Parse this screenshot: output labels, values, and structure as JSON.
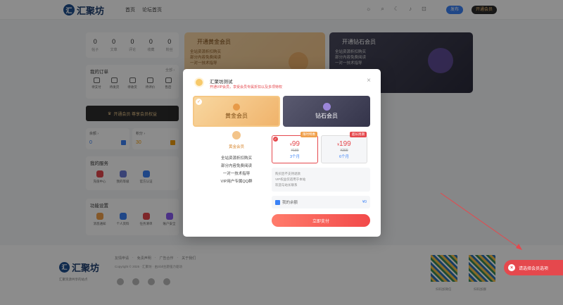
{
  "header": {
    "logo_char": "汇",
    "logo_text": "汇聚坊",
    "nav": [
      "首页",
      "论坛首页"
    ],
    "publish_label": "发布",
    "vip_label": "开通会员"
  },
  "stats": [
    {
      "value": "0",
      "label": "帖子"
    },
    {
      "value": "0",
      "label": "文章"
    },
    {
      "value": "0",
      "label": "评论"
    },
    {
      "value": "0",
      "label": "收藏"
    },
    {
      "value": "0",
      "label": "粉丝"
    }
  ],
  "orders": {
    "title": "我的订单",
    "more": "全部 ›",
    "items": [
      "待支付",
      "待发货",
      "待收货",
      "待评价",
      "售后"
    ]
  },
  "vip_bar": {
    "label": "开通会员 尊享会员权益"
  },
  "balance_card": {
    "title": "余额 ›",
    "value": "0"
  },
  "points_card": {
    "title": "积分 ›",
    "value": "30"
  },
  "services": {
    "title": "我的服务",
    "items": [
      "充值中心",
      "我的等级",
      "官方认证"
    ]
  },
  "settings": {
    "title": "功能设置",
    "items": [
      "消息通知",
      "个人资料",
      "任务清单",
      "账户安全"
    ]
  },
  "bg_gold": {
    "title": "开通黄金会员",
    "lines": [
      "全站资源折扣购买",
      "部分内容免费阅读",
      "一对一技术指导"
    ]
  },
  "bg_diamond": {
    "title": "开通钻石会员",
    "lines": [
      "全站资源折扣购买",
      "部分内容免费阅读",
      "一对一技术指导"
    ]
  },
  "footer": {
    "logo_char": "汇",
    "logo_text": "汇聚坊",
    "sub": "汇聚资源共享的站点",
    "links": [
      "友情申请",
      "免责声明",
      "广告合作",
      "关于我们"
    ],
    "copyright": "Copyright © 2025 · 汇聚坊 · 由zibll主题强力驱动",
    "qr_labels": [
      "扫码加微信",
      "扫码加群"
    ]
  },
  "modal": {
    "user_name": "汇聚坊测试",
    "user_desc": "开通VIP会员，享受会员专属折扣以及多项特权",
    "close": "×",
    "tab_gold": "黄金会员",
    "tab_diamond": "钻石会员",
    "gold_name": "黄金会员",
    "features": [
      "全站资源折扣购买",
      "部分内容免费阅读",
      "一对一技术指导",
      "VIP用户专属QQ群"
    ],
    "plans": [
      {
        "tag": "限时特惠",
        "price": "99",
        "old": "¥189",
        "duration": "3个月"
      },
      {
        "tag": "超长周期",
        "price": "199",
        "old": "¥299",
        "duration": "6个月"
      }
    ],
    "currency": "¥",
    "notes": [
      "购买后不支持退款",
      "VIP权益仅适用于本站",
      "欢迎与站长联系"
    ],
    "balance_label": "我的余额",
    "balance_value": "¥0",
    "pay_label": "立即支付"
  },
  "toast": {
    "text": "请选择会员选项",
    "icon": "close-circle-icon"
  },
  "colors": {
    "accent": "#e5484d",
    "blue": "#3b82f6",
    "gold": "#f0b36b"
  }
}
